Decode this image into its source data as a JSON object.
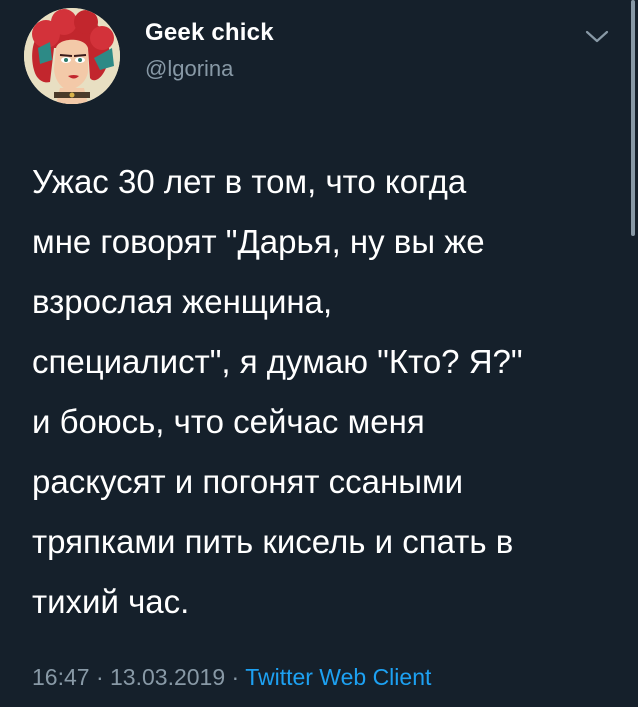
{
  "author": {
    "display_name": "Geek chick",
    "handle": "@lgorina",
    "avatar_icon": "illustrated-redhead-avatar"
  },
  "tweet": {
    "text": "Ужас 30 лет в том, что когда\nмне говорят \"Дарья, ну вы же\nвзрослая женщина,\nспециалист\", я думаю \"Кто? Я?\"\nи боюсь, что сейчас меня\nраскусят и погонят ссаными\nтряпками пить кисель и спать в\nтихий час.",
    "time": "16:47",
    "separator": "·",
    "date": "13.03.2019",
    "source": "Twitter Web Client"
  },
  "icons": {
    "menu": "chevron-down-icon"
  },
  "colors": {
    "background": "#15202b",
    "primary_text": "#ffffff",
    "secondary_text": "#8899a6",
    "link": "#1da1f2"
  }
}
